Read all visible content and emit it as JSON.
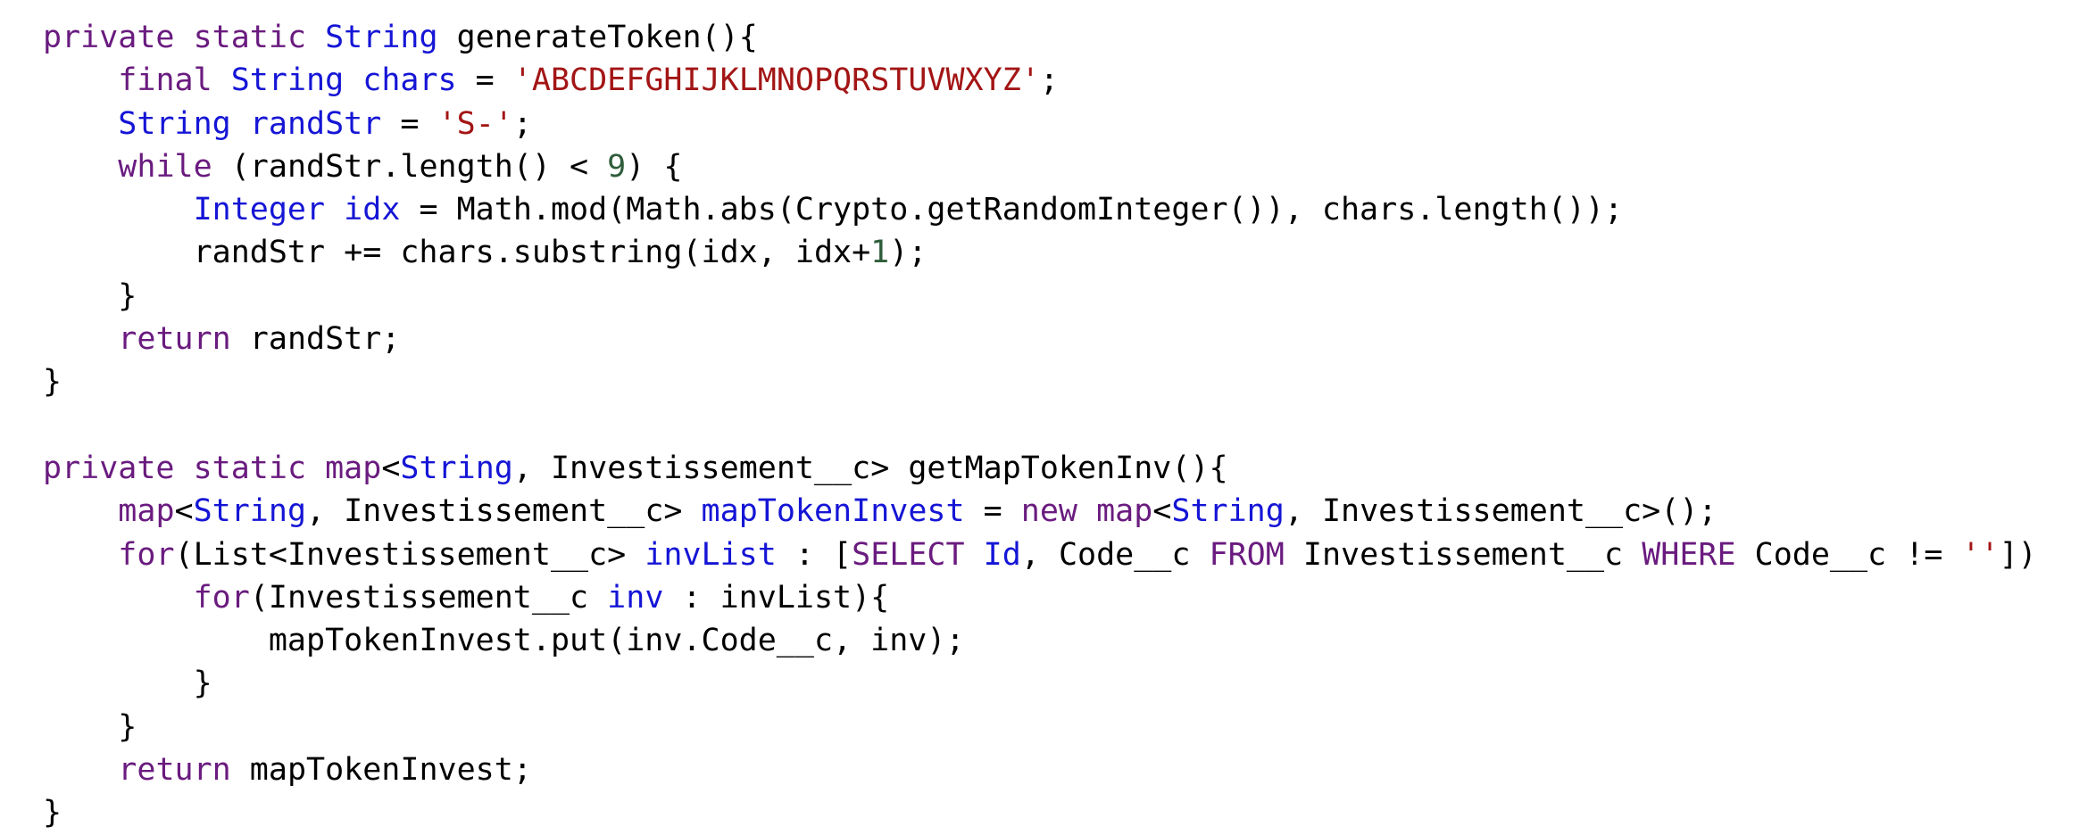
{
  "colors": {
    "plain": "#000000",
    "keyword": "#6a1b7f",
    "type": "#1515d6",
    "string": "#a31515",
    "number": "#2e5d3a"
  },
  "code_lines": [
    [
      {
        "t": "private",
        "k": "keyword"
      },
      {
        "t": " "
      },
      {
        "t": "static",
        "k": "keyword"
      },
      {
        "t": " "
      },
      {
        "t": "String",
        "k": "type"
      },
      {
        "t": " generateToken(){"
      }
    ],
    [
      {
        "t": "    "
      },
      {
        "t": "final",
        "k": "keyword"
      },
      {
        "t": " "
      },
      {
        "t": "String",
        "k": "type"
      },
      {
        "t": " "
      },
      {
        "t": "chars",
        "k": "type"
      },
      {
        "t": " = "
      },
      {
        "t": "'ABCDEFGHIJKLMNOPQRSTUVWXYZ'",
        "k": "string"
      },
      {
        "t": ";"
      }
    ],
    [
      {
        "t": "    "
      },
      {
        "t": "String",
        "k": "type"
      },
      {
        "t": " "
      },
      {
        "t": "randStr",
        "k": "type"
      },
      {
        "t": " = "
      },
      {
        "t": "'S-'",
        "k": "string"
      },
      {
        "t": ";"
      }
    ],
    [
      {
        "t": "    "
      },
      {
        "t": "while",
        "k": "keyword"
      },
      {
        "t": " (randStr.length() < "
      },
      {
        "t": "9",
        "k": "number"
      },
      {
        "t": ") {"
      }
    ],
    [
      {
        "t": "        "
      },
      {
        "t": "Integer",
        "k": "type"
      },
      {
        "t": " "
      },
      {
        "t": "idx",
        "k": "type"
      },
      {
        "t": " = Math.mod(Math.abs(Crypto.getRandomInteger()), chars.length());"
      }
    ],
    [
      {
        "t": "        randStr += chars.substring(idx, idx+"
      },
      {
        "t": "1",
        "k": "number"
      },
      {
        "t": ");"
      }
    ],
    [
      {
        "t": "    }"
      }
    ],
    [
      {
        "t": "    "
      },
      {
        "t": "return",
        "k": "keyword"
      },
      {
        "t": " randStr;"
      }
    ],
    [
      {
        "t": "}"
      }
    ],
    [],
    [
      {
        "t": "private",
        "k": "keyword"
      },
      {
        "t": " "
      },
      {
        "t": "static",
        "k": "keyword"
      },
      {
        "t": " "
      },
      {
        "t": "map",
        "k": "keyword"
      },
      {
        "t": "<"
      },
      {
        "t": "String",
        "k": "type"
      },
      {
        "t": ", Investissement__c> getMapTokenInv(){"
      }
    ],
    [
      {
        "t": "    "
      },
      {
        "t": "map",
        "k": "keyword"
      },
      {
        "t": "<"
      },
      {
        "t": "String",
        "k": "type"
      },
      {
        "t": ", Investissement__c> "
      },
      {
        "t": "mapTokenInvest",
        "k": "type"
      },
      {
        "t": " = "
      },
      {
        "t": "new",
        "k": "keyword"
      },
      {
        "t": " "
      },
      {
        "t": "map",
        "k": "keyword"
      },
      {
        "t": "<"
      },
      {
        "t": "String",
        "k": "type"
      },
      {
        "t": ", Investissement__c>();"
      }
    ],
    [
      {
        "t": "    "
      },
      {
        "t": "for",
        "k": "keyword"
      },
      {
        "t": "(List<Investissement__c> "
      },
      {
        "t": "invList",
        "k": "type"
      },
      {
        "t": " : ["
      },
      {
        "t": "SELECT",
        "k": "keyword"
      },
      {
        "t": " "
      },
      {
        "t": "Id",
        "k": "type"
      },
      {
        "t": ", Code__c "
      },
      {
        "t": "FROM",
        "k": "keyword"
      },
      {
        "t": " Investissement__c "
      },
      {
        "t": "WHERE",
        "k": "keyword"
      },
      {
        "t": " Code__c != "
      },
      {
        "t": "''",
        "k": "string"
      },
      {
        "t": "])"
      }
    ],
    [
      {
        "t": "        "
      },
      {
        "t": "for",
        "k": "keyword"
      },
      {
        "t": "(Investissement__c "
      },
      {
        "t": "inv",
        "k": "type"
      },
      {
        "t": " : invList){"
      }
    ],
    [
      {
        "t": "            mapTokenInvest.put(inv.Code__c, inv);"
      }
    ],
    [
      {
        "t": "        }"
      }
    ],
    [
      {
        "t": "    }"
      }
    ],
    [
      {
        "t": "    "
      },
      {
        "t": "return",
        "k": "keyword"
      },
      {
        "t": " mapTokenInvest;"
      }
    ],
    [
      {
        "t": "}"
      }
    ]
  ]
}
